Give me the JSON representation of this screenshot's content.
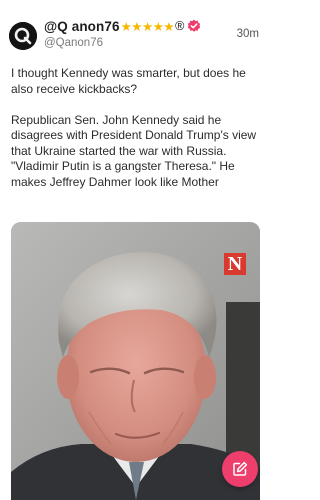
{
  "post": {
    "display_name": "@Q anon76",
    "rating_stars": "★★★★★",
    "registered_mark": "®",
    "handle": "@Qanon76",
    "timestamp": "30m",
    "paragraphs": [
      "I thought Kennedy was smarter, but does he also receive kickbacks?",
      "Republican Sen. John Kennedy said he disagrees with President Donald Trump's view that Ukraine started the war with Russia. \"Vladimir Putin is a gangster Theresa.\" He makes Jeffrey Dahmer look like Mother"
    ]
  },
  "media": {
    "logo_letter": "N"
  },
  "icons": {
    "avatar": "q-logo-avatar",
    "verified": "verified-badge-icon",
    "compose": "compose-edit-icon"
  },
  "colors": {
    "star": "#f5b800",
    "verified": "#ee3e6c",
    "fab": "#ee3e6c",
    "news_logo": "#d9392e"
  }
}
